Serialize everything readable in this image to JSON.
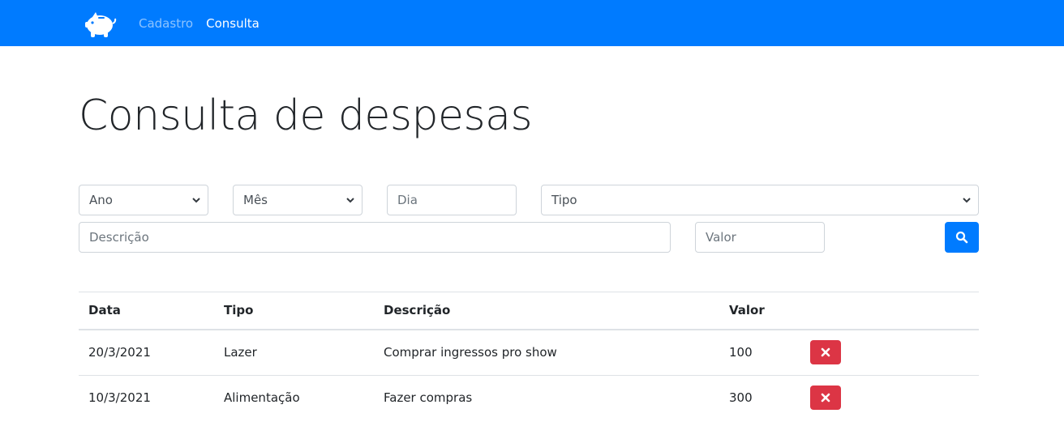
{
  "nav": {
    "logo_icon": "piggy-bank-icon",
    "links": [
      {
        "label": "Cadastro",
        "state": "inactive"
      },
      {
        "label": "Consulta",
        "state": "active"
      }
    ]
  },
  "page": {
    "title": "Consulta de despesas"
  },
  "filters": {
    "ano": {
      "selected": "Ano"
    },
    "mes": {
      "selected": "Mês"
    },
    "dia": {
      "placeholder": "Dia"
    },
    "tipo": {
      "selected": "Tipo"
    },
    "descricao": {
      "placeholder": "Descrição"
    },
    "valor": {
      "placeholder": "Valor"
    },
    "search_icon": "search-icon"
  },
  "table": {
    "headers": [
      "Data",
      "Tipo",
      "Descrição",
      "Valor"
    ],
    "rows": [
      {
        "data": "20/3/2021",
        "tipo": "Lazer",
        "descricao": "Comprar ingressos pro show",
        "valor": "100",
        "action_icon": "close-icon"
      },
      {
        "data": "10/3/2021",
        "tipo": "Alimentação",
        "descricao": "Fazer compras",
        "valor": "300",
        "action_icon": "close-icon"
      }
    ]
  },
  "colors": {
    "primary": "#007bff",
    "danger": "#dc3545",
    "border": "#ced4da"
  }
}
